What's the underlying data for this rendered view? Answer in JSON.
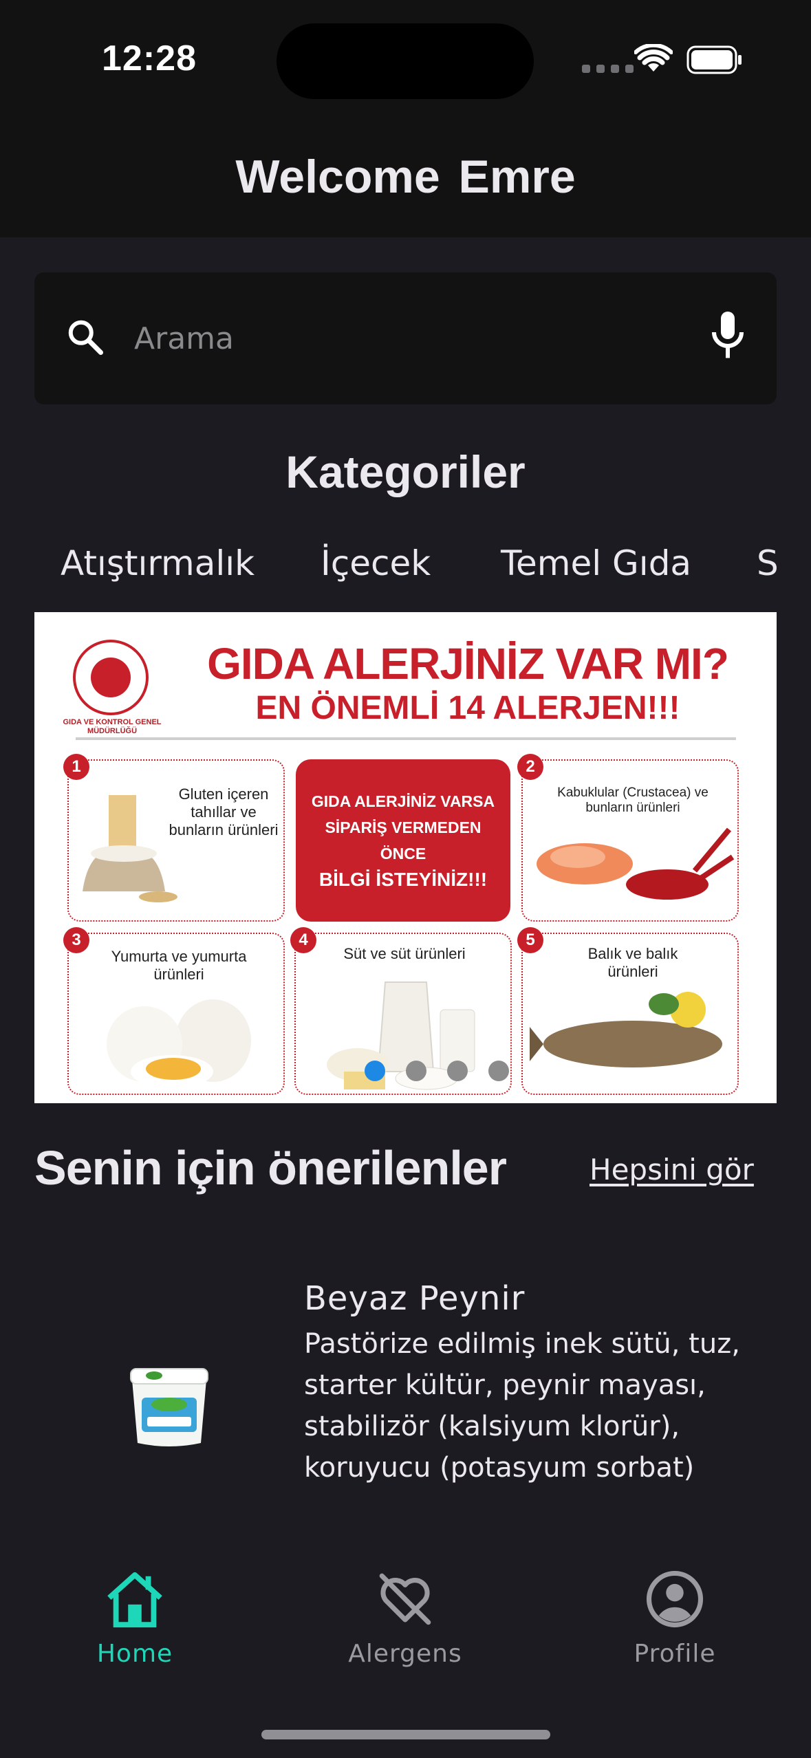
{
  "status_bar": {
    "time": "12:28"
  },
  "header": {
    "title": "Welcome  Emre"
  },
  "search": {
    "placeholder": "Arama",
    "value": ""
  },
  "categories": {
    "title": "Kategoriler",
    "items": [
      "Atıştırmalık",
      "İçecek",
      "Temel Gıda",
      "S"
    ]
  },
  "banner": {
    "logo_text": "GIDA VE KONTROL GENEL MÜDÜRLÜĞÜ",
    "heading": "GIDA ALERJİNİZ VAR MI?",
    "subheading": "EN ÖNEMLİ 14 ALERJEN!!!",
    "center_line1": "GIDA ALERJİNİZ VARSA",
    "center_line2": "SİPARİŞ VERMEDEN ÖNCE",
    "center_line3": "BİLGİ İSTEYİNİZ!!!",
    "tiles": [
      {
        "num": "1",
        "text": "Gluten içeren tahıllar ve bunların ürünleri"
      },
      {
        "num": "2",
        "text": "Kabuklular (Crustacea) ve bunların ürünleri"
      },
      {
        "num": "3",
        "text": "Yumurta ve yumurta ürünleri"
      },
      {
        "num": "4",
        "text": "Süt ve süt ürünleri"
      },
      {
        "num": "5",
        "text": "Balık ve balık ürünleri"
      }
    ],
    "page_count": 4,
    "active_page": 1
  },
  "recommendations": {
    "title": "Senin için önerilenler",
    "see_all": "Hepsini gör",
    "items": [
      {
        "name": "Beyaz Peynir",
        "description": "Pastörize edilmiş inek sütü, tuz, starter kültür, peynir mayası, stabilizör (kalsiyum klorür), koruyucu (potasyum sorbat)"
      }
    ]
  },
  "tabbar": {
    "items": [
      {
        "label": "Home",
        "icon": "home-icon",
        "active": true
      },
      {
        "label": "Alergens",
        "icon": "heart-off-icon",
        "active": false
      },
      {
        "label": "Profile",
        "icon": "account-circle-icon",
        "active": false
      }
    ]
  },
  "colors": {
    "background": "#1c1b21",
    "header_background": "#121212",
    "accent": "#1ed6b8",
    "banner_red": "#c8202a",
    "carousel_active": "#1e88e5"
  }
}
